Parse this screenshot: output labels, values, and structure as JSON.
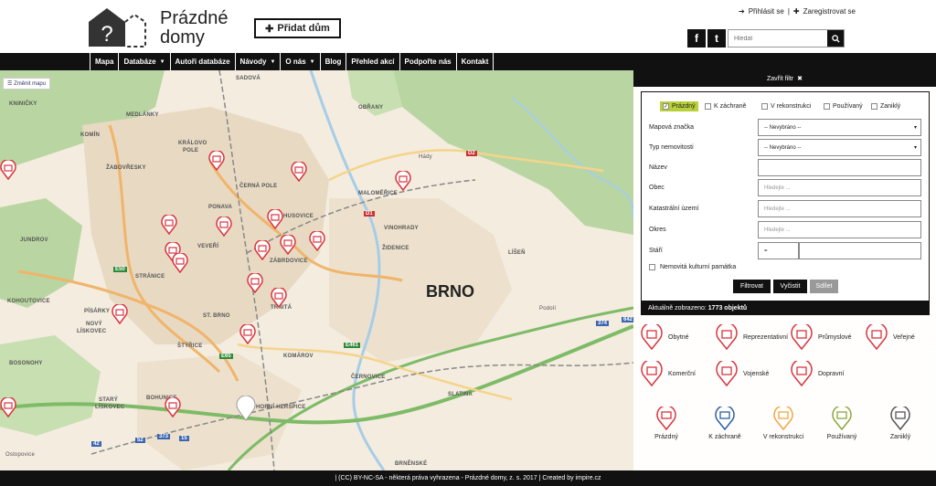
{
  "header": {
    "logo_line1": "Prázdné",
    "logo_line2": "domy",
    "add_button": "Přidat dům",
    "login": "Přihlásit se",
    "register": "Zaregistrovat se",
    "search_placeholder": "Hledat",
    "social": [
      {
        "icon": "facebook-icon",
        "glyph": "f"
      },
      {
        "icon": "twitter-icon",
        "glyph": "t"
      }
    ]
  },
  "nav": {
    "items": [
      {
        "label": "Mapa",
        "dropdown": false
      },
      {
        "label": "Databáze",
        "dropdown": true
      },
      {
        "label": "Autoři databáze",
        "dropdown": false
      },
      {
        "label": "Návody",
        "dropdown": true
      },
      {
        "label": "O nás",
        "dropdown": true
      },
      {
        "label": "Blog",
        "dropdown": false
      },
      {
        "label": "Přehled akcí",
        "dropdown": false
      },
      {
        "label": "Podpořte nás",
        "dropdown": false
      },
      {
        "label": "Kontakt",
        "dropdown": false
      }
    ]
  },
  "map": {
    "change_map": "Změnit mapu",
    "city": "BRNO",
    "labels": [
      {
        "text": "KNINIČKY"
      },
      {
        "text": "MEDLÁNKY"
      },
      {
        "text": "SADOVÁ"
      },
      {
        "text": "OBŘANY"
      },
      {
        "text": "KOMÍN"
      },
      {
        "text": "KRÁLOVO"
      },
      {
        "text": "POLE"
      },
      {
        "text": "ŽABOVŘESKY"
      },
      {
        "text": "ČERNÁ POLE"
      },
      {
        "text": "MALOMĚŘICE"
      },
      {
        "text": "PONAVA"
      },
      {
        "text": "HUSOVICE"
      },
      {
        "text": "VINOHRADY"
      },
      {
        "text": "JUNDROV"
      },
      {
        "text": "VEVEŘÍ"
      },
      {
        "text": "ŽIDENICE"
      },
      {
        "text": "ZÁBRDOVICE"
      },
      {
        "text": "LÍŠEŇ"
      },
      {
        "text": "STRÁNICE"
      },
      {
        "text": "KOHOUTOVICE"
      },
      {
        "text": "TRNITÁ"
      },
      {
        "text": "PÍSÁRKY"
      },
      {
        "text": "NOVÝ"
      },
      {
        "text": "LÍSKOVEC"
      },
      {
        "text": "ŠTÝŘICE"
      },
      {
        "text": "ST. BRNO"
      },
      {
        "text": "KOMÁROV"
      },
      {
        "text": "ČERNOVICE"
      },
      {
        "text": "BOSONOHY"
      },
      {
        "text": "STARÝ"
      },
      {
        "text": "LÍSKOVEC"
      },
      {
        "text": "BOHUNICE"
      },
      {
        "text": "HORNÍ HERŠPICE"
      },
      {
        "text": "SLATINA"
      },
      {
        "text": "Ostopovice"
      },
      {
        "text": "Podolí"
      },
      {
        "text": "BRNĚNSKÉ"
      },
      {
        "text": "Hády"
      }
    ],
    "roads": [
      "E50",
      "E65",
      "E461",
      "D1",
      "D2",
      "374",
      "642",
      "42",
      "52",
      "373",
      "15"
    ]
  },
  "filter": {
    "close_label": "Zavřít filtr",
    "statuses": [
      {
        "label": "Prázdný",
        "checked": true
      },
      {
        "label": "K záchraně",
        "checked": false
      },
      {
        "label": "V rekonstrukci",
        "checked": false
      },
      {
        "label": "Používaný",
        "checked": false
      },
      {
        "label": "Zaniklý",
        "checked": false
      }
    ],
    "fields": {
      "map_marker": {
        "label": "Mapová značka",
        "value": "-- Nevybráno --"
      },
      "building_type": {
        "label": "Typ nemovitosti",
        "value": "-- Nevybráno --"
      },
      "name": {
        "label": "Název",
        "placeholder": ""
      },
      "municipality": {
        "label": "Obec",
        "placeholder": "Hledejte ..."
      },
      "cadastral": {
        "label": "Katastrální území",
        "placeholder": "Hledejte ..."
      },
      "district": {
        "label": "Okres",
        "placeholder": "Hledejte ..."
      },
      "age": {
        "label": "Stáří",
        "operator": "="
      },
      "monument": {
        "label": "Nemovitá kulturní památka"
      }
    },
    "buttons": {
      "filter": "Filtrovat",
      "clear": "Vyčistit",
      "share": "Sdílet"
    },
    "count_prefix": "Aktuálně zobrazeno:",
    "count_value": "1773 objektů"
  },
  "legend": {
    "types": [
      {
        "label": "Obytné",
        "icon": "residential-icon"
      },
      {
        "label": "Reprezentativní",
        "icon": "representative-icon"
      },
      {
        "label": "Průmyslové",
        "icon": "industrial-icon"
      },
      {
        "label": "Veřejné",
        "icon": "public-icon"
      },
      {
        "label": "Komerční",
        "icon": "commercial-icon"
      },
      {
        "label": "Vojenské",
        "icon": "military-icon"
      },
      {
        "label": "Dopravní",
        "icon": "transport-icon"
      }
    ],
    "states": [
      {
        "label": "Prázdný",
        "color": "#d9343c"
      },
      {
        "label": "K záchraně",
        "color": "#2d5fa0"
      },
      {
        "label": "V rekonstrukci",
        "color": "#f0a540"
      },
      {
        "label": "Používaný",
        "color": "#8aa83a"
      },
      {
        "label": "Zaniklý",
        "color": "#555555"
      }
    ]
  },
  "footer": {
    "text": "| (CC) BY-NC-SA - některá práva vyhrazena - Prázdné domy, z. s. 2017 | Created by impire.cz"
  },
  "colors": {
    "accent_red": "#d9343c",
    "check_green": "#b8d13a",
    "dark": "#111111"
  }
}
